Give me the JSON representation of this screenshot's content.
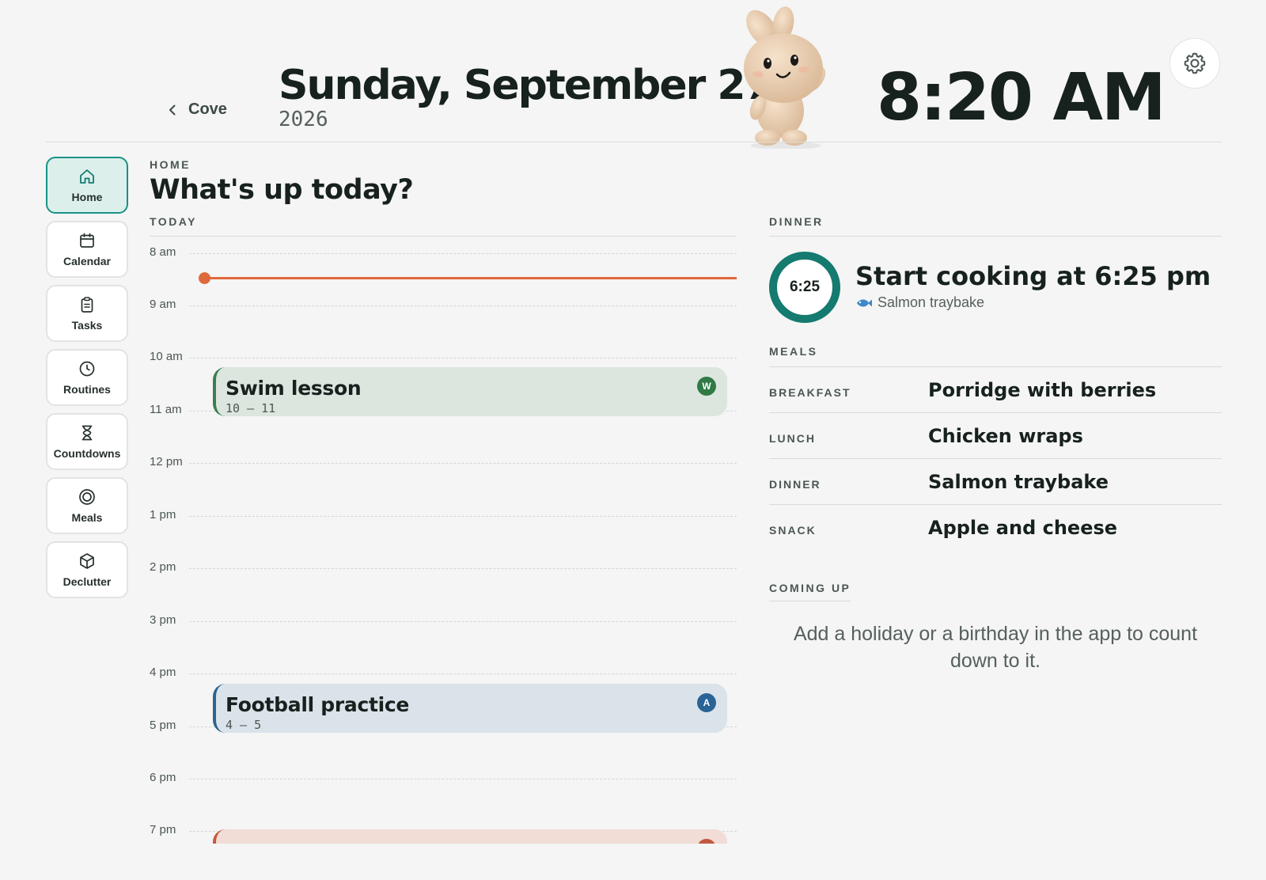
{
  "header": {
    "back_label": "Cove",
    "date": "Sunday, September 27",
    "year": "2026",
    "time": "8:20 AM"
  },
  "sidebar": {
    "items": [
      {
        "label": "Home",
        "icon": "home-icon",
        "active": true
      },
      {
        "label": "Calendar",
        "icon": "calendar-icon"
      },
      {
        "label": "Tasks",
        "icon": "clipboard-icon"
      },
      {
        "label": "Routines",
        "icon": "clock-icon"
      },
      {
        "label": "Countdowns",
        "icon": "hourglass-icon"
      },
      {
        "label": "Meals",
        "icon": "plate-icon"
      },
      {
        "label": "Declutter",
        "icon": "box-icon"
      }
    ]
  },
  "main": {
    "eyebrow": "HOME",
    "title": "What's up today?",
    "today_label": "TODAY",
    "hours": [
      "8 am",
      "9 am",
      "10 am",
      "11 am",
      "12 pm",
      "1 pm",
      "2 pm",
      "3 pm",
      "4 pm",
      "5 pm",
      "6 pm",
      "7 pm"
    ],
    "events": [
      {
        "title": "Swim lesson",
        "time": "10 – 11",
        "badge": "W",
        "color": "#3e7d50"
      },
      {
        "title": "Football practice",
        "time": "4 – 5",
        "badge": "A",
        "color": "#2c6491"
      }
    ]
  },
  "dinner": {
    "label": "DINNER",
    "ring_time": "6:25",
    "headline": "Start cooking at 6:25 pm",
    "dish": "Salmon traybake",
    "accent": "#157a70"
  },
  "meals": {
    "label": "MEALS",
    "rows": [
      {
        "label": "BREAKFAST",
        "value": "Porridge with berries"
      },
      {
        "label": "LUNCH",
        "value": "Chicken wraps"
      },
      {
        "label": "DINNER",
        "value": "Salmon traybake"
      },
      {
        "label": "SNACK",
        "value": "Apple and cheese"
      }
    ]
  },
  "coming_up": {
    "label": "COMING UP",
    "empty_text": "Add a holiday or a birthday in the app to count down to it."
  },
  "colors": {
    "now_line": "#e0683d",
    "active_nav": "#1a9186"
  }
}
